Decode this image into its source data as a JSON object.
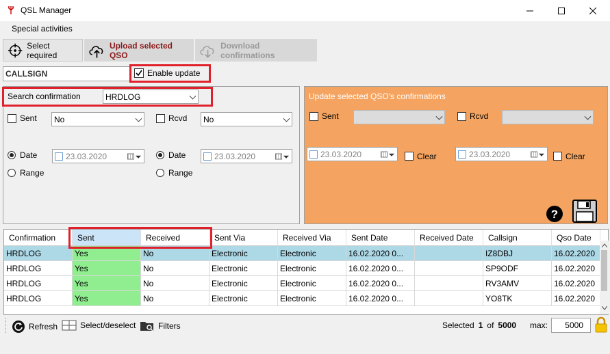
{
  "window": {
    "title": "QSL Manager"
  },
  "menu": {
    "items": [
      "Special activities"
    ]
  },
  "toolbar": {
    "select_required": "Select required",
    "upload_selected": "Upload selected QSO",
    "download_confirmations": "Download confirmations"
  },
  "callsign": {
    "value": "CALLSIGN"
  },
  "enable_update": {
    "label": "Enable update",
    "checked": true
  },
  "search": {
    "label": "Search confirmation",
    "value": "HRDLOG",
    "sent_label": "Sent",
    "sent_value": "No",
    "rcvd_label": "Rcvd",
    "rcvd_value": "No",
    "date_label": "Date",
    "range_label": "Range",
    "sent_date": "23.03.2020",
    "rcvd_date": "23.03.2020"
  },
  "update_panel": {
    "title": "Update selected QSO's confirmations",
    "sent_label": "Sent",
    "rcvd_label": "Rcvd",
    "sent_date": "23.03.2020",
    "rcvd_date": "23.03.2020",
    "clear_label": "Clear",
    "colors": {
      "background": "#f4a460"
    }
  },
  "grid": {
    "columns": [
      "Confirmation",
      "Sent",
      "Received",
      "Sent Via",
      "Received Via",
      "Sent Date",
      "Received Date",
      "Callsign",
      "Qso Date"
    ],
    "rows": [
      [
        "HRDLOG",
        "Yes",
        "No",
        "Electronic",
        "Electronic",
        "16.02.2020 0...",
        "",
        "IZ8DBJ",
        "16.02.2020"
      ],
      [
        "HRDLOG",
        "Yes",
        "No",
        "Electronic",
        "Electronic",
        "16.02.2020 0...",
        "",
        "SP9ODF",
        "16.02.2020"
      ],
      [
        "HRDLOG",
        "Yes",
        "No",
        "Electronic",
        "Electronic",
        "16.02.2020 0...",
        "",
        "RV3AMV",
        "16.02.2020"
      ],
      [
        "HRDLOG",
        "Yes",
        "No",
        "Electronic",
        "Electronic",
        "16.02.2020 0...",
        "",
        "YO8TK",
        "16.02.2020"
      ]
    ],
    "colors": {
      "selected_row": "#add8e6",
      "sent_yes": "#90ee90"
    }
  },
  "statusbar": {
    "refresh": "Refresh",
    "select_deselect": "Select/deselect",
    "filters": "Filters",
    "selected_label": "Selected",
    "selected_count": "1",
    "of_label": "of",
    "total": "5000",
    "max_label": "max:",
    "max_value": "5000"
  }
}
